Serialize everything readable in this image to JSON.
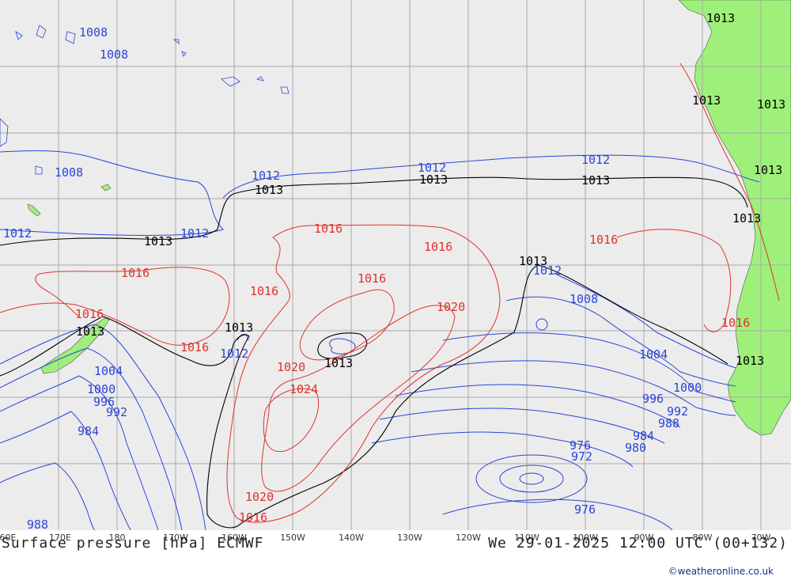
{
  "title": "Surface pressure [hPa] ECMWF",
  "valid_time": "We 29-01-2025 12:00 UTC (00+132)",
  "credit": "©weatheronline.co.uk",
  "colors": {
    "ocean": "#ececec",
    "land": "#9ef07a",
    "grid": "#a9a9a9",
    "isobar_low": "#2a45d8",
    "isobar_ref": "#000000",
    "isobar_high": "#e0322a"
  },
  "lon_labels": [
    "60E",
    "170E",
    "180",
    "170W",
    "160W",
    "150W",
    "140W",
    "130W",
    "120W",
    "110W",
    "100W",
    "90W",
    "80W",
    "70W"
  ],
  "isobar_labels": {
    "l1008a": "1008",
    "l1008b": "1008",
    "l1008c": "1008",
    "l1012a": "1012",
    "l1012b": "1012",
    "l1012c": "1012",
    "l1012d": "1012",
    "l1012e": "1012",
    "l1012f": "1012",
    "l1012g": "1012",
    "l1013a": "1013",
    "l1013b": "1013",
    "l1013c": "1013",
    "l1013d": "1013",
    "l1013e": "1013",
    "l1013f": "1013",
    "l1013g": "1013",
    "l1013h": "1013",
    "l1013i": "1013",
    "l1013j": "1013",
    "l1013k": "1013",
    "l1013l": "1013",
    "l1013m": "1013",
    "l1013n": "1013",
    "l1016a": "1016",
    "l1016b": "1016",
    "l1016c": "1016",
    "l1016d": "1016",
    "l1016e": "1016",
    "l1016f": "1016",
    "l1016g": "1016",
    "l1016h": "1016",
    "l1016i": "1016",
    "l1016j": "1016",
    "l1020a": "1020",
    "l1020b": "1020",
    "l1020c": "1020",
    "l1024": "1024",
    "l1008d": "1008",
    "l1004a": "1004",
    "l1004b": "1004",
    "l1000a": "1000",
    "l1000b": "1000",
    "l996a": "996",
    "l996b": "996",
    "l992a": "992",
    "l992b": "992",
    "l988a": "988",
    "l988b": "988",
    "l984a": "984",
    "l984b": "984",
    "l980": "980",
    "l976a": "976",
    "l976b": "976",
    "l972": "972"
  }
}
